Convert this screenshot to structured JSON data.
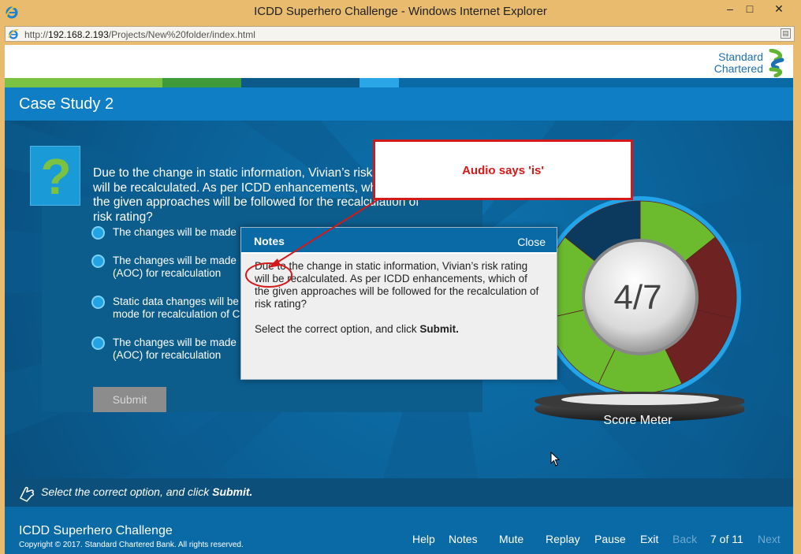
{
  "window": {
    "title": "ICDD Superhero Challenge - Windows Internet Explorer",
    "url_prefix": "http://",
    "url_host": "192.168.2.193",
    "url_path": "/Projects/New%20folder/index.html",
    "minimize": "–",
    "maximize": "□",
    "close": "✕",
    "compat_icon": "compat-view-icon"
  },
  "brand": {
    "line1": "Standard",
    "line2": "Chartered",
    "colors": {
      "blue": "#1d6fb3",
      "green": "#5fb532"
    }
  },
  "header": {
    "title": "Case Study 2"
  },
  "question": {
    "icon": "?",
    "text": "Due to the change in static information, Vivian’s risk rating will be recalculated. As per ICDD enhancements, which of the given approaches will be followed for the recalculation of risk rating?",
    "options": [
      {
        "text": "The changes will be made"
      },
      {
        "text": "The changes will be made\n(AOC) for recalculation"
      },
      {
        "text": "Static data changes will be\nmode for recalculation of C"
      },
      {
        "text": "The changes will be made\n(AOC) for recalculation"
      }
    ],
    "submit_label": "Submit"
  },
  "score_meter": {
    "score": "4/7",
    "label": "Score Meter",
    "correct": 4,
    "total": 7,
    "colors": {
      "correct": "#6cbb2f",
      "wrong": "#6e2222",
      "pending": "#0c3a5e",
      "ring": "#23a4e8"
    }
  },
  "instruction": {
    "prefix": "Select the correct option, and click ",
    "action": "Submit."
  },
  "footer": {
    "title": "ICDD Superhero Challenge",
    "copyright": "Copyright © 2017. Standard Chartered Bank. All rights reserved.",
    "help": "Help",
    "notes": "Notes",
    "mute": "Mute",
    "replay": "Replay",
    "pause": "Pause",
    "exit": "Exit",
    "back": "Back",
    "progress": "7 of 11",
    "next": "Next"
  },
  "notes_popup": {
    "title": "Notes",
    "close": "Close",
    "body": "Due to the change in static information, Vivian’s risk rating will be recalculated. As per ICDD enhancements, which of the given approaches will be followed for the recalculation of risk rating?",
    "instr_prefix": "Select the correct option, and click ",
    "instr_action": "Submit."
  },
  "annotation": {
    "text": "Audio says 'is'",
    "color": "#d31919"
  }
}
